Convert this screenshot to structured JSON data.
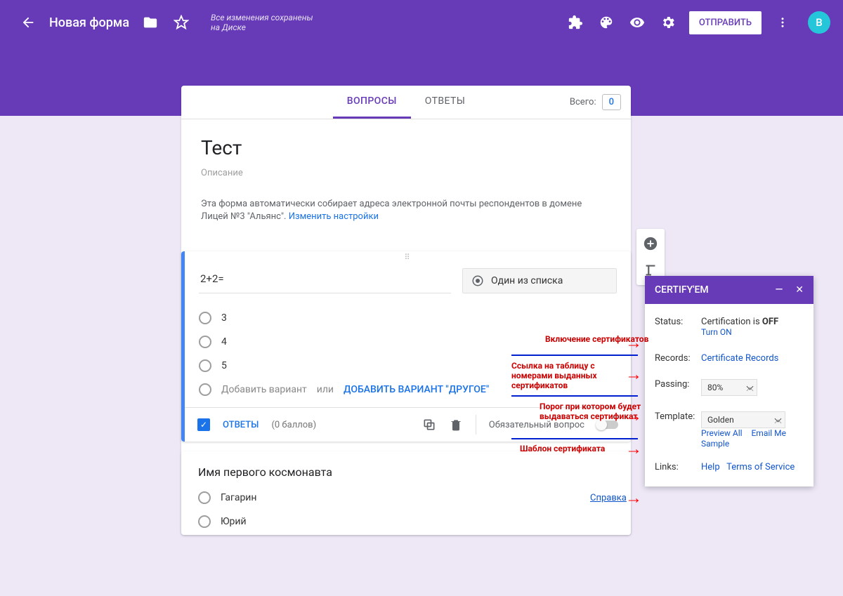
{
  "header": {
    "title": "Новая форма",
    "save_status": "Все изменения сохранены на Диске",
    "send": "ОТПРАВИТЬ",
    "avatar": "В"
  },
  "tabs": {
    "questions": "ВОПРОСЫ",
    "answers": "ОТВЕТЫ",
    "total_label": "Всего:",
    "total_value": "0"
  },
  "form": {
    "title": "Тест",
    "desc": "Описание",
    "info_text": "Эта форма автоматически собирает адреса электронной почты респондентов в домене Лицей №3 \"Альянс\".  ",
    "info_link": "Изменить настройки"
  },
  "q1": {
    "text": "2+2=",
    "type": "Один из списка",
    "options": [
      "3",
      "4",
      "5"
    ],
    "add_option": "Добавить вариант",
    "or": "  или  ",
    "add_other": "ДОБАВИТЬ ВАРИАНТ \"ДРУГОЕ\"",
    "answers": "ОТВЕТЫ",
    "points": "(0 баллов)",
    "required": "Обязательный вопрос"
  },
  "q2": {
    "title": "Имя первого космонавта",
    "options": [
      "Гагарин",
      "Юрий"
    ]
  },
  "addon": {
    "title": "CERTIFY'EM",
    "rows": {
      "status_label": "Status:",
      "status_text": "Certification is ",
      "status_state": "OFF",
      "turn_on": "Turn ON",
      "records_label": "Records:",
      "records_link": "Certificate Records",
      "passing_label": "Passing:",
      "passing_val": "80%",
      "template_label": "Template:",
      "template_val": "Golden",
      "preview": "Preview All",
      "email_sample": "Email Me Sample",
      "links_label": "Links:",
      "help": "Help",
      "tos": "Terms of Service"
    }
  },
  "annotations": {
    "a1": "Включение сертификатов",
    "a2": "Ссылка на таблицу с номерами выданных  сертификатов",
    "a3": "Порог при котором будет выдаваться сертификат",
    "a4": "Шаблон сертификата",
    "help": "Справка"
  }
}
